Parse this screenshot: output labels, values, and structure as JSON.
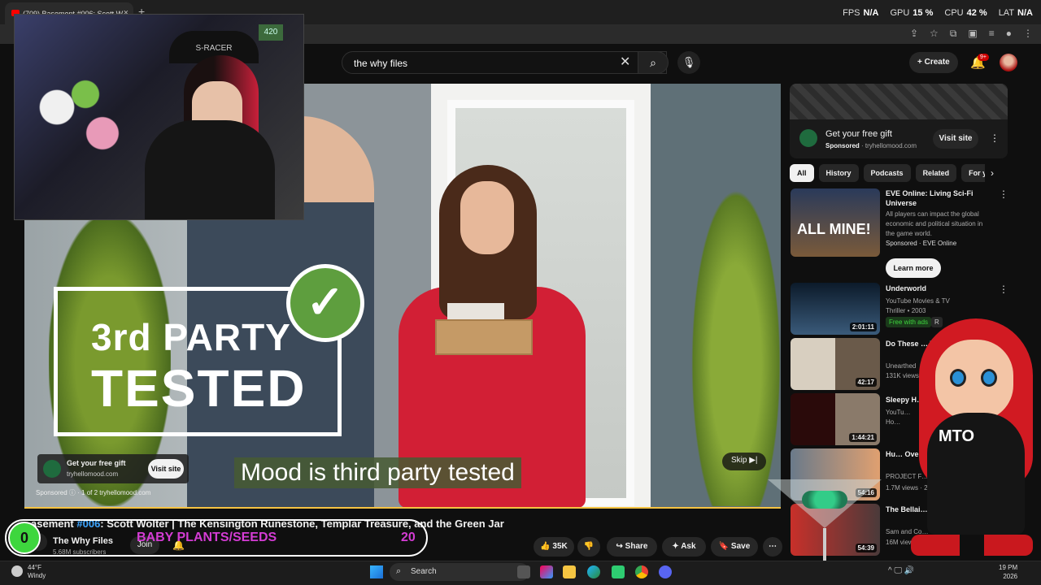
{
  "browser": {
    "tab_title": "(709) Basement #006: Scott W",
    "new_tab": "+",
    "tab_close": "×",
    "toolbar_icons": [
      "⇪",
      "☆",
      "⧉",
      "▣",
      "≡",
      "●",
      "⋮"
    ]
  },
  "stats": {
    "fps_label": "FPS",
    "fps_value": "N/A",
    "gpu_label": "GPU",
    "gpu_value": "15 %",
    "cpu_label": "CPU",
    "cpu_value": "42 %",
    "lat_label": "LAT",
    "lat_value": "N/A"
  },
  "header": {
    "search_value": "the why files",
    "clear_icon": "✕",
    "search_icon": "⌕",
    "mic_icon": "🎙",
    "create_label": "+ Create",
    "bell_icon": "🔔",
    "bell_badge": "9+"
  },
  "webcam": {
    "chair_text": "S-RACER",
    "sign_text": "420"
  },
  "video": {
    "badge_line1": "3rd PARTY",
    "badge_line2": "TESTED",
    "check": "✓",
    "subtitle": "Mood is third party tested",
    "ad_title": "Get your free gift",
    "ad_url": "tryhellomood.com",
    "ad_button": "Visit site",
    "sponsored_line": "Sponsored ⓘ · 1 of 2   tryhellomood.com",
    "skip_label": "Skip ▶|"
  },
  "below": {
    "title_prefix": "asement ",
    "title_hash": "#006",
    "title_rest": ": Scott Wolter | The Kensington Runestone, Templar Treasure, and the Green Jar",
    "channel_name": "The Why Files",
    "channel_subs": "5.68M subscribers",
    "join_label": "Join",
    "bell_icon": "🔔",
    "pill_count_left": "0",
    "pill_text": "BABY PLANTS/SEEDS",
    "pill_count_right": "20",
    "like_label": "👍 35K",
    "dislike_label": "👎",
    "share_label": "↪ Share",
    "ask_label": "✦ Ask",
    "save_label": "🔖 Save",
    "more_label": "⋯"
  },
  "sidebar": {
    "ad_title": "Get your free gift",
    "ad_sponsored": "Sponsored",
    "ad_url": "· tryhellomood.com",
    "ad_button": "Visit site",
    "ad_dots": "⋮",
    "chips": [
      "All",
      "History",
      "Podcasts",
      "Related",
      "For you"
    ],
    "chips_next": "›",
    "videos": [
      {
        "title": "EVE Online: Living Sci-Fi Universe",
        "meta1": "All players can impact the global economic and political situation in the game world.",
        "meta2": "Sponsored · EVE Online",
        "thumb_text": "ALL MINE!",
        "duration": ""
      },
      {
        "title": "Underworld",
        "meta1": "YouTube Movies & TV",
        "meta2": "Thriller • 2003",
        "duration": "2:01:11"
      },
      {
        "title": "Do These … The Knig…",
        "meta1": "Unearthed",
        "meta2": "131K views",
        "duration": "42:17"
      },
      {
        "title": "Sleepy H…",
        "meta1": "YouTu…",
        "meta2": "Ho…",
        "duration": "1:44:21"
      },
      {
        "title": "Hu… Ove… i…",
        "meta1": "PROJECT F…",
        "meta2": "1.7M views · 2…",
        "duration": "54:16"
      },
      {
        "title": "The Bellai… A P… Hell…",
        "meta1": "Sam and Co…",
        "meta2": "16M views · … ago",
        "duration": "54:39"
      }
    ],
    "learn_more": "Learn more",
    "free_with_ads": "Free with ads",
    "rating": "R"
  },
  "mascot": {
    "label": "MTO"
  },
  "taskbar": {
    "temp": "44°F",
    "condition": "Windy",
    "search_label": "Search",
    "search_icon": "⌕",
    "time": "19 PM",
    "date": "2026",
    "tray_icons": "^  🖵  🔊"
  },
  "colors": {
    "yt_bg": "#0f0f0f",
    "progress": "#f6c342",
    "pill_text": "#d43cd4",
    "pill_circle": "#3ed63e",
    "hash_link": "#3ea6ff"
  }
}
